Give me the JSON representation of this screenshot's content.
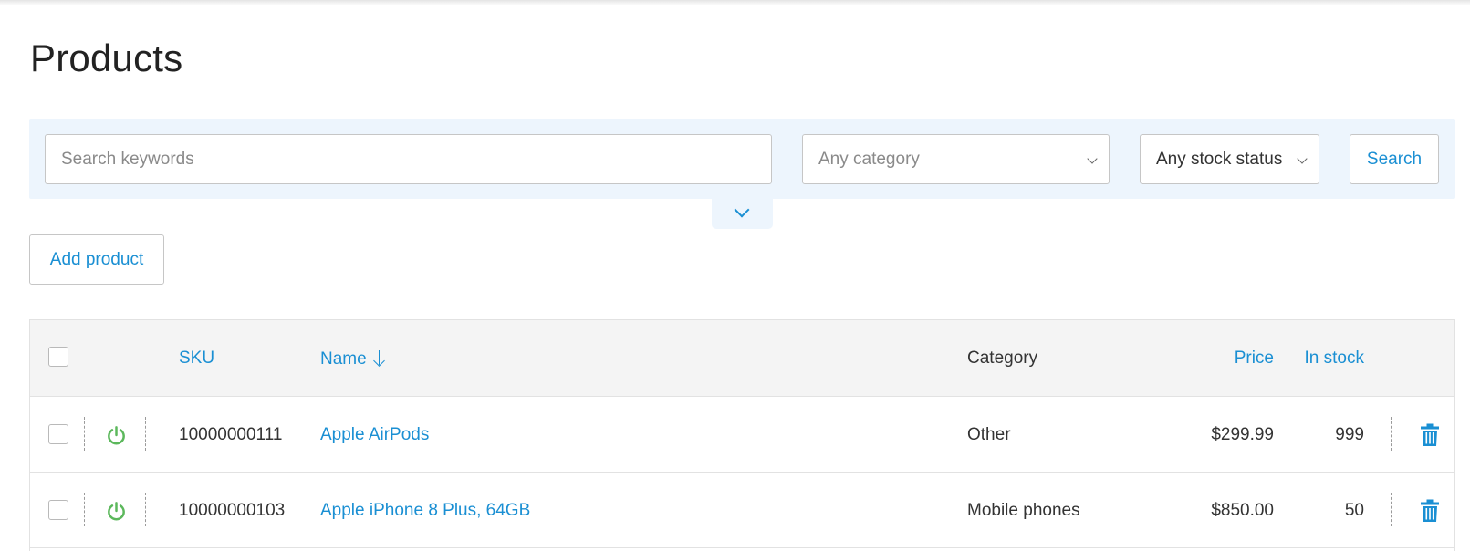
{
  "page": {
    "title": "Products"
  },
  "filters": {
    "keywords_placeholder": "Search keywords",
    "keywords_value": "",
    "category_selected": "Any category",
    "stock_status_selected": "Any stock status",
    "search_label": "Search"
  },
  "actions": {
    "add_product_label": "Add product"
  },
  "table": {
    "columns": {
      "sku": "SKU",
      "name": "Name",
      "category": "Category",
      "price": "Price",
      "in_stock": "In stock"
    },
    "sort": {
      "column": "name",
      "direction": "descending"
    },
    "rows": [
      {
        "enabled": true,
        "sku": "10000000111",
        "name": "Apple AirPods",
        "category": "Other",
        "price": "$299.99",
        "in_stock": "999"
      },
      {
        "enabled": true,
        "sku": "10000000103",
        "name": "Apple iPhone 8 Plus, 64GB",
        "category": "Mobile phones",
        "price": "$850.00",
        "in_stock": "50"
      }
    ]
  },
  "icons": {
    "expand": "chevron-down-icon",
    "sort": "arrow-down-icon",
    "status": "power-icon",
    "delete": "trash-icon"
  },
  "colors": {
    "accent": "#1a8fd3",
    "panel_bg": "#edf5fd",
    "enabled_green": "#5cb85c",
    "header_bg": "#f4f4f4"
  }
}
